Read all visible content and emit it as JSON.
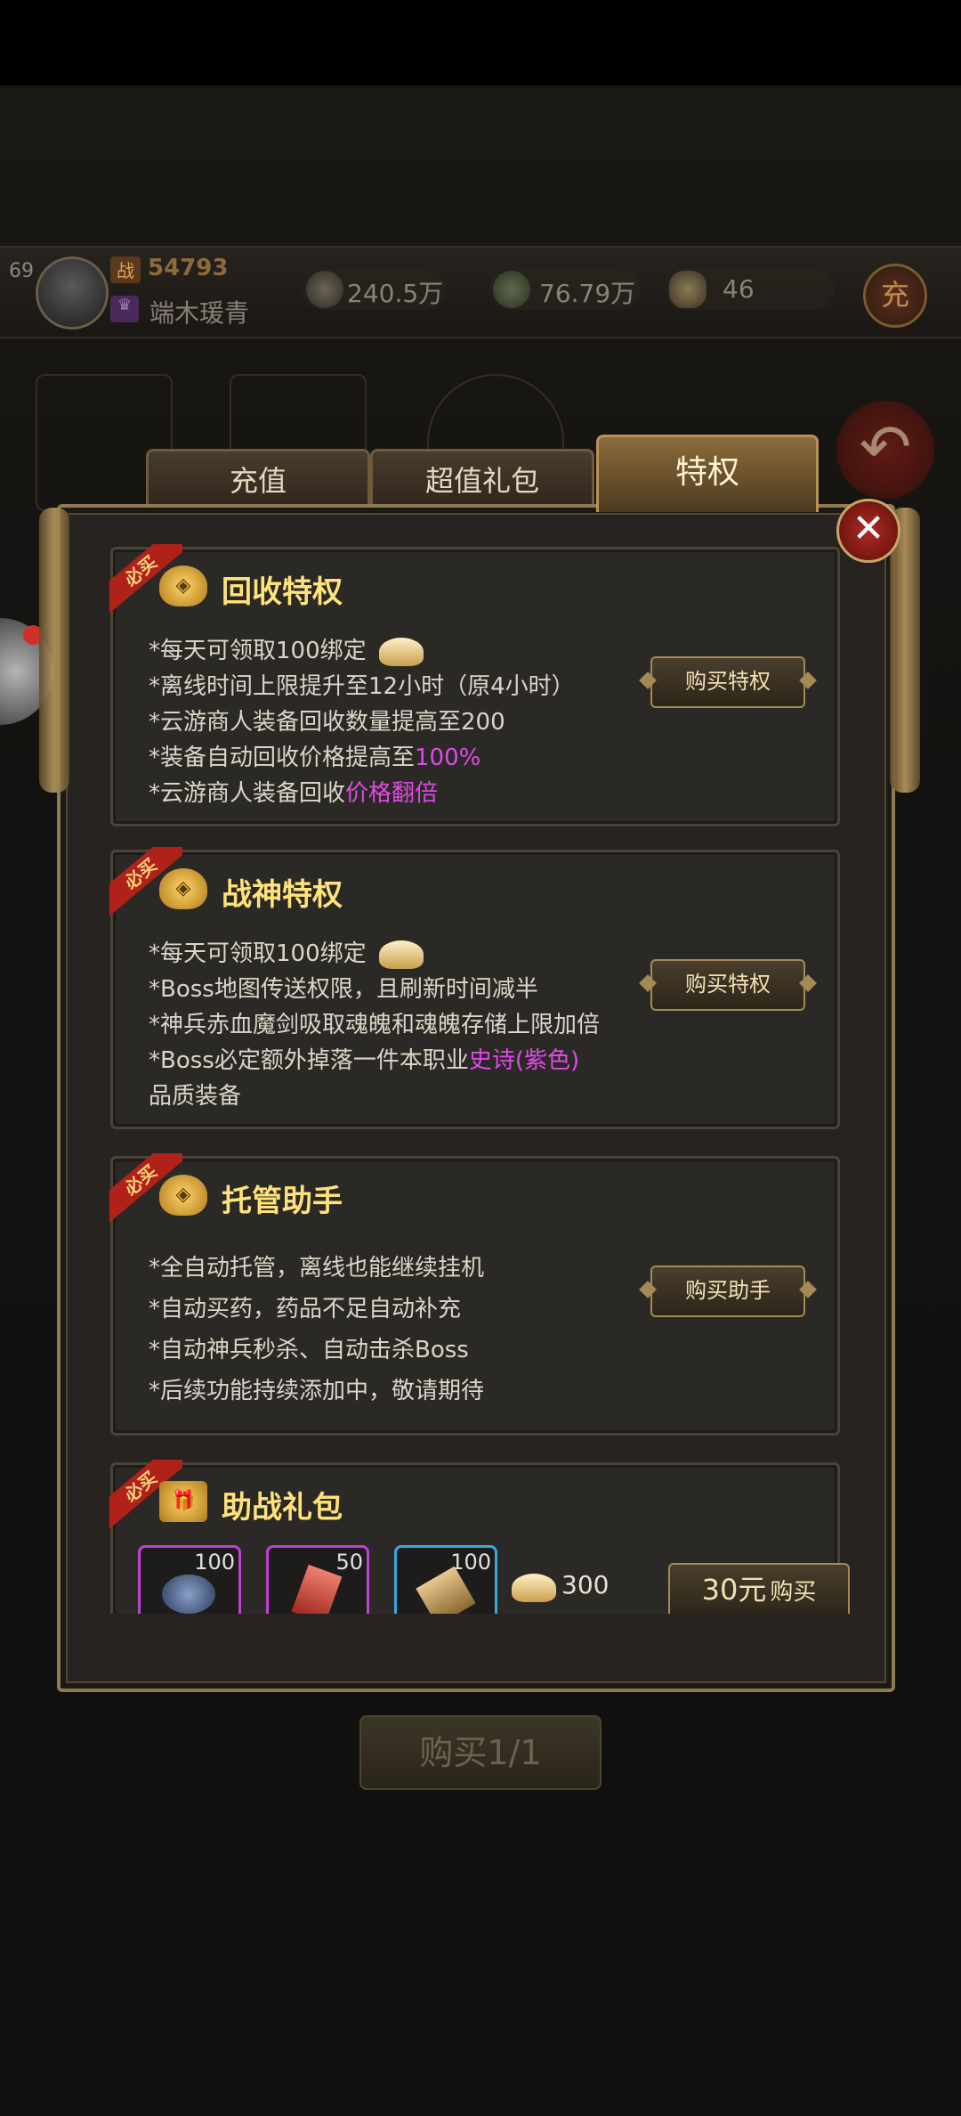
{
  "player": {
    "level": "69",
    "combat_power": "54793",
    "name": "端木瑗青",
    "power_icon_glyph": "战",
    "guild_icon_glyph": "♛"
  },
  "resources": [
    {
      "icon": "money-bag-icon",
      "value": "240.5万"
    },
    {
      "icon": "jade-coin-icon",
      "value": "76.79万"
    },
    {
      "icon": "gold-ingot-icon",
      "value": "46"
    }
  ],
  "recharge_button": "充",
  "tabs": [
    {
      "label": "充值",
      "active": false
    },
    {
      "label": "超值礼包",
      "active": false
    },
    {
      "label": "特权",
      "active": true
    }
  ],
  "close_glyph": "✕",
  "ribbon_label": "必买",
  "cards": [
    {
      "title": "回收特权",
      "lines": [
        {
          "text": "*每天可领取100绑定",
          "highlight": ""
        },
        {
          "text": "*离线时间上限提升至12小时（原4小时）",
          "highlight": ""
        },
        {
          "text": "*云游商人装备回收数量提高至200",
          "highlight": ""
        },
        {
          "text": "*装备自动回收价格提高至",
          "highlight": "100%"
        },
        {
          "text": "*云游商人装备回收",
          "highlight": "价格翻倍"
        }
      ],
      "button": "购买特权"
    },
    {
      "title": "战神特权",
      "lines": [
        {
          "text": "*每天可领取100绑定",
          "highlight": ""
        },
        {
          "text": "*Boss地图传送权限，且刷新时间减半",
          "highlight": ""
        },
        {
          "text": "*神兵赤血魔剑吸取魂魄和魂魄存储上限加倍",
          "highlight": ""
        },
        {
          "text": "*Boss必定额外掉落一件本职业",
          "highlight": "史诗(紫色)"
        },
        {
          "text": "品质装备",
          "highlight": ""
        }
      ],
      "button": "购买特权"
    },
    {
      "title": "托管助手",
      "lines": [
        {
          "text": "*全自动托管，离线也能继续挂机",
          "highlight": ""
        },
        {
          "text": "*自动买药，药品不足自动补充",
          "highlight": ""
        },
        {
          "text": "*自动神兵秒杀、自动击杀Boss",
          "highlight": ""
        },
        {
          "text": "*后续功能持续添加中，敬请期待",
          "highlight": ""
        }
      ],
      "button": "购买助手"
    },
    {
      "title": "助战礼包",
      "items": [
        {
          "count": "100",
          "border": "#c040d8"
        },
        {
          "count": "50",
          "border": "#c040d8"
        },
        {
          "count": "100",
          "border": "#3aa8e0"
        }
      ],
      "ingot_amount": "300",
      "price": "30元",
      "price_suffix": "购买"
    }
  ],
  "bottom_button": "购买1/1",
  "colors": {
    "highlight": "#e04ae8",
    "title_gold": "#ffe27a",
    "ribbon_red": "#b0211a"
  }
}
